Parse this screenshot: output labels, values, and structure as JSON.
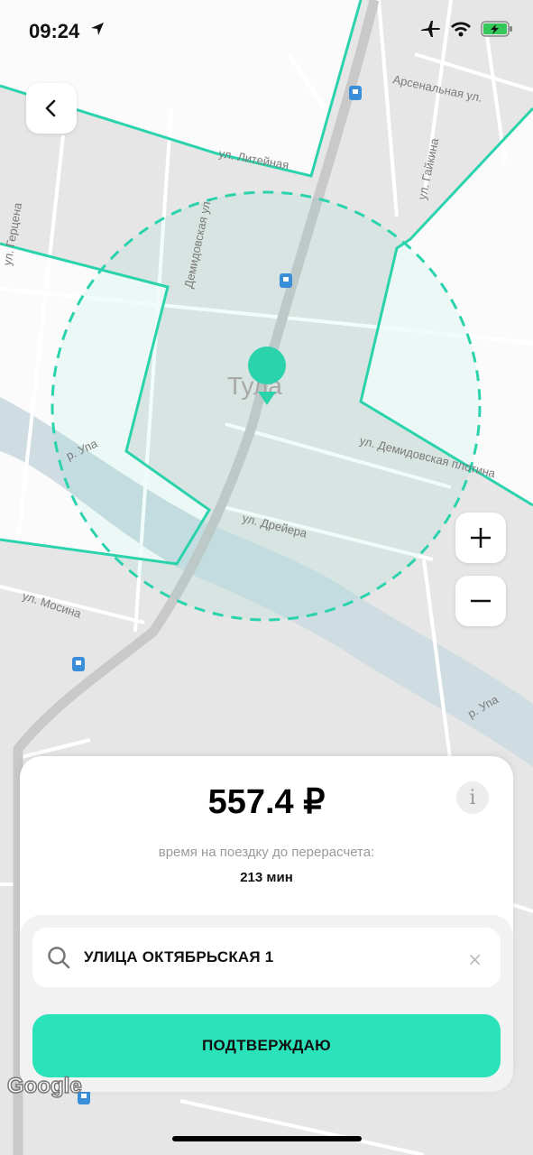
{
  "status_bar": {
    "time": "09:24",
    "icons": [
      "location-arrow-icon",
      "airplane-icon",
      "wifi-icon",
      "battery-charging-icon"
    ]
  },
  "map": {
    "city_label": "Тула",
    "street_labels": {
      "litejnaya": "ул. Литейная",
      "arsenalnaya": "Арсенальная ул.",
      "demidovskaya": "Демидовская ул.",
      "gaykina": "ул. Гайкина",
      "gertsena": "ул. Герцена",
      "demidovskaya_plotina": "ул. Демидовская плотина",
      "dreyera": "ул. Дрейера",
      "mosina": "ул. Мосина",
      "upa_river_1": "р. Упа",
      "upa_river_2": "р. Упа"
    },
    "accent_color": "#2be3ba",
    "zone_color": "#2bd3ad"
  },
  "controls": {
    "back_icon": "chevron-left-icon",
    "zoom_in_icon": "plus-icon",
    "zoom_out_icon": "minus-icon"
  },
  "panel": {
    "price": "557.4 ₽",
    "info_label": "i",
    "recalc_label": "время на поездку до перерасчета:",
    "recalc_value": "213 мин",
    "search": {
      "value": "УЛИЦА ОКТЯБРЬСКАЯ 1",
      "icon": "search-icon",
      "clear_label": "×"
    },
    "confirm_label": "ПОДТВЕРЖДАЮ"
  },
  "attribution": "Google"
}
